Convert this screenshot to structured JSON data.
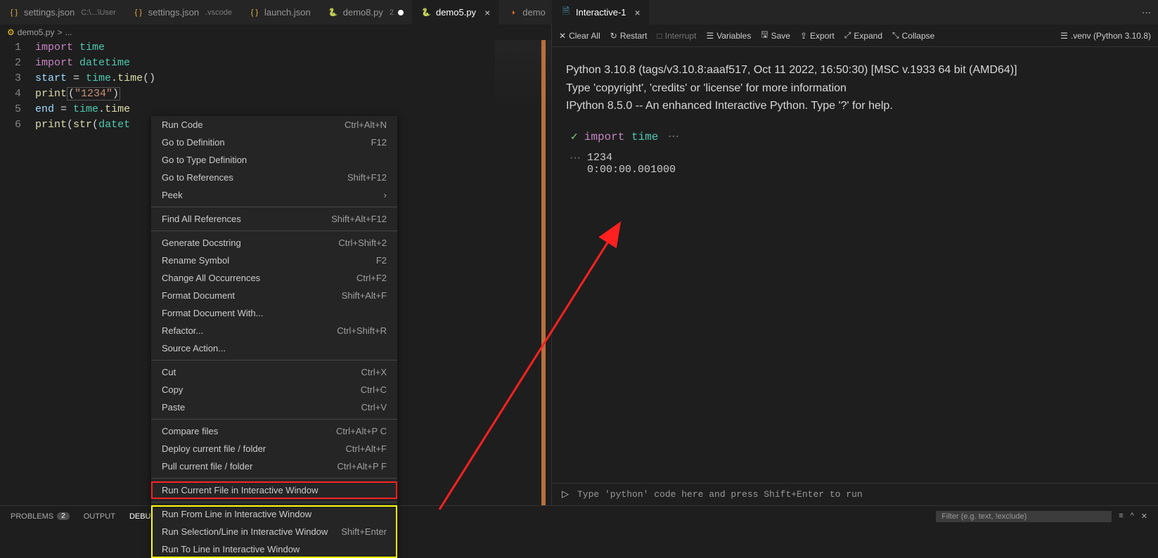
{
  "tabs_left": [
    {
      "icon": "braces",
      "label": "settings.json",
      "sub": "C:\\...\\User",
      "active": false,
      "modified": false
    },
    {
      "icon": "braces",
      "label": "settings.json",
      "sub": ".vscode",
      "active": false,
      "modified": false
    },
    {
      "icon": "braces",
      "label": "launch.json",
      "sub": "",
      "active": false,
      "modified": false
    },
    {
      "icon": "python",
      "label": "demo8.py",
      "sub": "2",
      "active": false,
      "modified": true
    },
    {
      "icon": "python",
      "label": "demo5.py",
      "sub": "",
      "active": true,
      "modified": false
    },
    {
      "icon": "jupyter",
      "label": "demo",
      "sub": "",
      "active": false,
      "modified": false
    }
  ],
  "tabs_right": [
    {
      "icon": "file",
      "label": "Interactive-1",
      "active": true
    }
  ],
  "breadcrumb": {
    "file": "demo5.py",
    "sep": ">",
    "rest": "..."
  },
  "code_lines": [
    {
      "n": "1",
      "tokens": [
        [
          "import ",
          "kw"
        ],
        [
          "time",
          "mod"
        ]
      ]
    },
    {
      "n": "2",
      "tokens": [
        [
          "import ",
          "kw"
        ],
        [
          "datetime",
          "mod"
        ]
      ]
    },
    {
      "n": "3",
      "tokens": [
        [
          "start",
          "var"
        ],
        [
          " = ",
          "op"
        ],
        [
          "time",
          "mod"
        ],
        [
          ".",
          "punc"
        ],
        [
          "time",
          "fn"
        ],
        [
          "()",
          "punc"
        ]
      ]
    },
    {
      "n": "4",
      "tokens": [
        [
          "print",
          "fn"
        ],
        [
          "(",
          "punc"
        ],
        [
          "\"1234\"",
          "str"
        ],
        [
          ")",
          "punc"
        ]
      ],
      "boxed": true
    },
    {
      "n": "5",
      "tokens": [
        [
          "end",
          "var"
        ],
        [
          " = ",
          "op"
        ],
        [
          "time",
          "mod"
        ],
        [
          ".",
          "punc"
        ],
        [
          "time",
          "fn"
        ]
      ]
    },
    {
      "n": "6",
      "tokens": [
        [
          "print",
          "fn"
        ],
        [
          "(",
          "punc"
        ],
        [
          "str",
          "fn"
        ],
        [
          "(",
          "punc"
        ],
        [
          "datet",
          "mod"
        ]
      ]
    }
  ],
  "context_menu": {
    "groups": [
      [
        {
          "label": "Run Code",
          "shortcut": "Ctrl+Alt+N"
        },
        {
          "label": "Go to Definition",
          "shortcut": "F12"
        },
        {
          "label": "Go to Type Definition",
          "shortcut": ""
        },
        {
          "label": "Go to References",
          "shortcut": "Shift+F12"
        },
        {
          "label": "Peek",
          "shortcut": "",
          "arrow": true
        }
      ],
      [
        {
          "label": "Find All References",
          "shortcut": "Shift+Alt+F12"
        }
      ],
      [
        {
          "label": "Generate Docstring",
          "shortcut": "Ctrl+Shift+2"
        },
        {
          "label": "Rename Symbol",
          "shortcut": "F2"
        },
        {
          "label": "Change All Occurrences",
          "shortcut": "Ctrl+F2"
        },
        {
          "label": "Format Document",
          "shortcut": "Shift+Alt+F"
        },
        {
          "label": "Format Document With...",
          "shortcut": ""
        },
        {
          "label": "Refactor...",
          "shortcut": "Ctrl+Shift+R"
        },
        {
          "label": "Source Action...",
          "shortcut": ""
        }
      ],
      [
        {
          "label": "Cut",
          "shortcut": "Ctrl+X"
        },
        {
          "label": "Copy",
          "shortcut": "Ctrl+C"
        },
        {
          "label": "Paste",
          "shortcut": "Ctrl+V"
        }
      ],
      [
        {
          "label": "Compare files",
          "shortcut": "Ctrl+Alt+P C"
        },
        {
          "label": "Deploy current file / folder",
          "shortcut": "Ctrl+Alt+F"
        },
        {
          "label": "Pull current file / folder",
          "shortcut": "Ctrl+Alt+P F"
        }
      ],
      [
        {
          "label": "Run Current File in Interactive Window",
          "shortcut": "",
          "hl": "red"
        }
      ],
      [
        {
          "label": "Run From Line in Interactive Window",
          "shortcut": "",
          "hl": "yellow"
        },
        {
          "label": "Run Selection/Line in Interactive Window",
          "shortcut": "Shift+Enter",
          "hl": "yellow"
        },
        {
          "label": "Run To Line in Interactive Window",
          "shortcut": "",
          "hl": "yellow"
        }
      ]
    ]
  },
  "toolbar": {
    "clear": "Clear All",
    "restart": "Restart",
    "interrupt": "Interrupt",
    "variables": "Variables",
    "save": "Save",
    "export": "Export",
    "expand": "Expand",
    "collapse": "Collapse",
    "env": ".venv (Python 3.10.8)"
  },
  "interactive": {
    "header1": "Python 3.10.8 (tags/v3.10.8:aaaf517, Oct 11 2022, 16:50:30) [MSC v.1933 64 bit (AMD64)]",
    "header2": "Type 'copyright', 'credits' or 'license' for more information",
    "header3": "IPython 8.5.0 -- An enhanced Interactive Python. Type '?' for help.",
    "cell_in": {
      "kw": "import",
      "mod": "time"
    },
    "out1": "1234",
    "out2": "0:00:00.001000",
    "input_placeholder": "Type 'python' code here and press Shift+Enter to run"
  },
  "bottom": {
    "problems": "PROBLEMS",
    "problems_count": "2",
    "output": "OUTPUT",
    "debug": "DEBUG CON",
    "filter_placeholder": "Filter (e.g. text, !exclude)"
  }
}
